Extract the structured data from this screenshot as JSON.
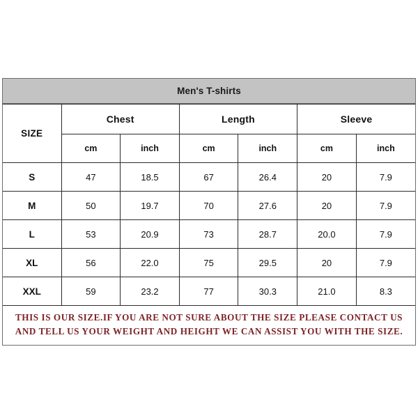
{
  "chart_data": {
    "type": "table",
    "title": "Men's T-shirts",
    "group_headers": [
      "SIZE",
      "Chest",
      "Length",
      "Sleeve"
    ],
    "unit_headers": [
      "cm",
      "inch",
      "cm",
      "inch",
      "cm",
      "inch"
    ],
    "categories": [
      "S",
      "M",
      "L",
      "XL",
      "XXL"
    ],
    "columns": [
      "SIZE",
      "Chest cm",
      "Chest inch",
      "Length cm",
      "Length inch",
      "Sleeve cm",
      "Sleeve inch"
    ],
    "rows": [
      [
        "S",
        "47",
        "18.5",
        "67",
        "26.4",
        "20",
        "7.9"
      ],
      [
        "M",
        "50",
        "19.7",
        "70",
        "27.6",
        "20",
        "7.9"
      ],
      [
        "L",
        "53",
        "20.9",
        "73",
        "28.7",
        "20.0",
        "7.9"
      ],
      [
        "XL",
        "56",
        "22.0",
        "75",
        "29.5",
        "20",
        "7.9"
      ],
      [
        "XXL",
        "59",
        "23.2",
        "77",
        "30.3",
        "21.0",
        "8.3"
      ]
    ],
    "series": [
      {
        "name": "Chest cm",
        "values": [
          47,
          50,
          53,
          56,
          59
        ]
      },
      {
        "name": "Chest inch",
        "values": [
          18.5,
          19.7,
          20.9,
          22.0,
          23.2
        ]
      },
      {
        "name": "Length cm",
        "values": [
          67,
          70,
          73,
          75,
          77
        ]
      },
      {
        "name": "Length inch",
        "values": [
          26.4,
          27.6,
          28.7,
          29.5,
          30.3
        ]
      },
      {
        "name": "Sleeve cm",
        "values": [
          20,
          20,
          20.0,
          20,
          21.0
        ]
      },
      {
        "name": "Sleeve inch",
        "values": [
          7.9,
          7.9,
          7.9,
          7.9,
          8.3
        ]
      }
    ],
    "footer_note": "THIS IS OUR SIZE.IF YOU ARE NOT SURE ABOUT THE SIZE  PLEASE CONTACT US AND TELL US YOUR WEIGHT AND HEIGHT WE CAN ASSIST YOU WITH THE SIZE.",
    "colors": {
      "title_bar": "#c3c3c3",
      "grid_line": "#2b2b2b",
      "frame": "#6e6e6e",
      "note_text": "#7d2428",
      "cell_background": "#ffffff"
    }
  }
}
